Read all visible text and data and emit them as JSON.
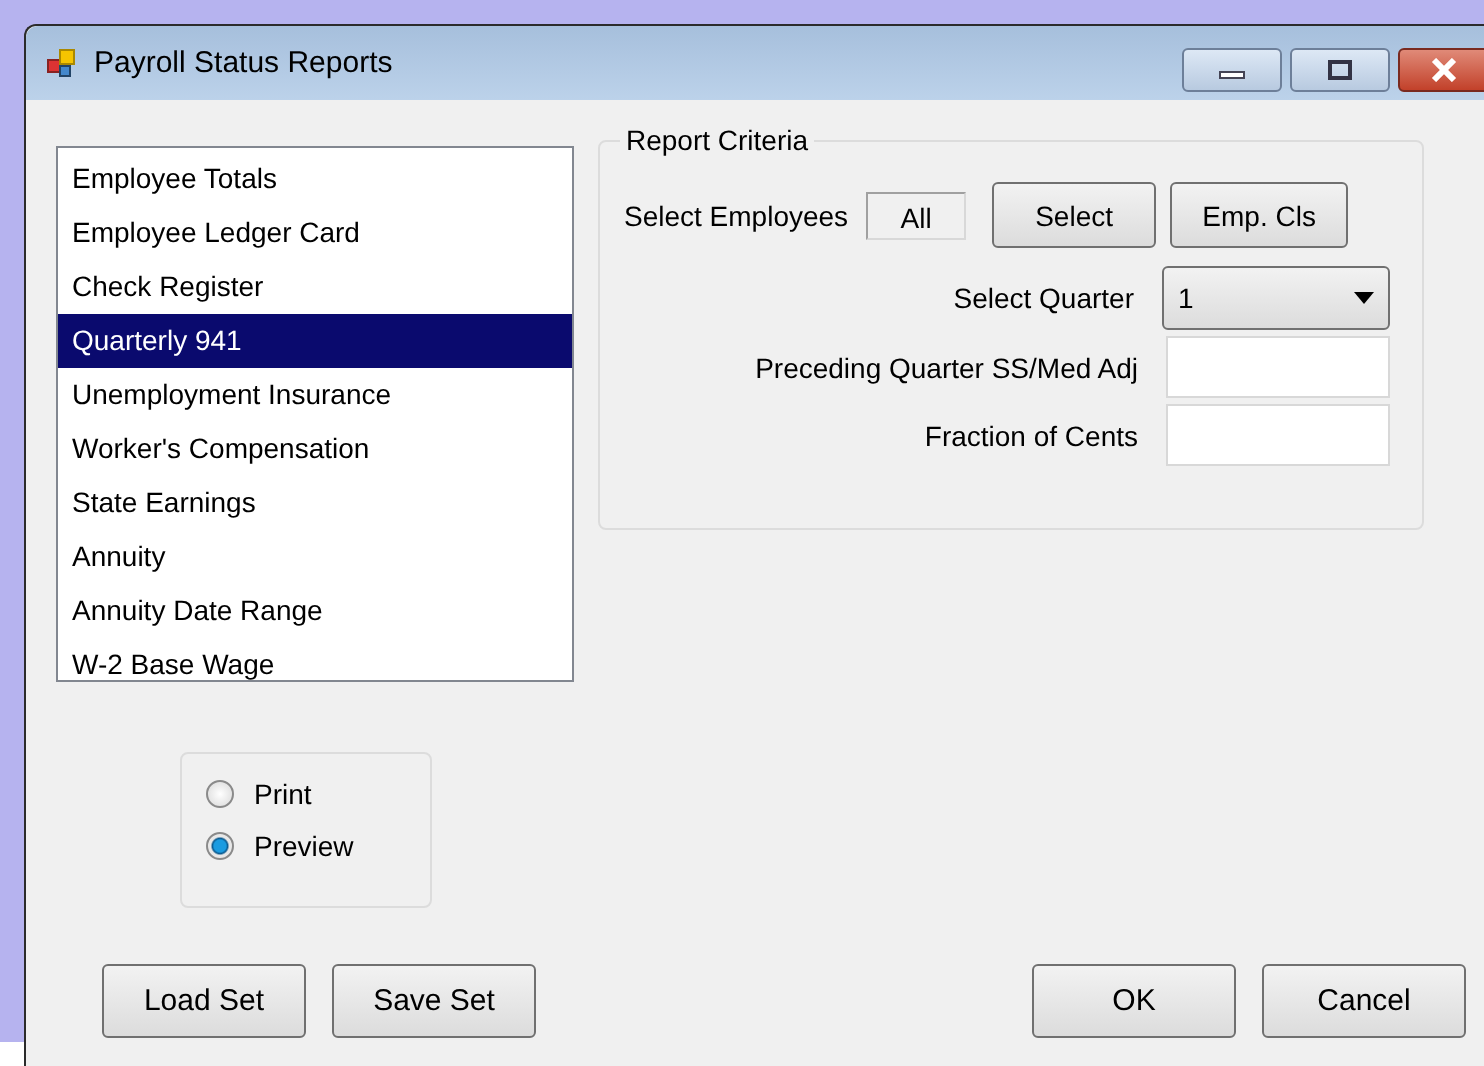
{
  "window": {
    "title": "Payroll Status Reports"
  },
  "reports": [
    {
      "label": "Employee Totals",
      "selected": false
    },
    {
      "label": "Employee Ledger Card",
      "selected": false
    },
    {
      "label": "Check Register",
      "selected": false
    },
    {
      "label": "Quarterly 941",
      "selected": true
    },
    {
      "label": "Unemployment Insurance",
      "selected": false
    },
    {
      "label": "Worker's Compensation",
      "selected": false
    },
    {
      "label": "State Earnings",
      "selected": false
    },
    {
      "label": "Annuity",
      "selected": false
    },
    {
      "label": "Annuity Date Range",
      "selected": false
    },
    {
      "label": "W-2 Base Wage",
      "selected": false
    }
  ],
  "report_criteria": {
    "title": "Report Criteria",
    "select_employees_label": "Select Employees",
    "select_employees_value": "All",
    "buttons": [
      "Select",
      "Emp. Cls"
    ],
    "select_quarter_label": "Select Quarter",
    "select_quarter_value": "1",
    "preceding_quarter_label": "Preceding Quarter SS/Med Adj",
    "fraction_label": "Fraction of Cents"
  },
  "output": [
    {
      "label": "Print",
      "selected": false
    },
    {
      "label": "Preview",
      "selected": true
    }
  ],
  "left_buttons": [
    "Load Set",
    "Save Set"
  ],
  "right_buttons": [
    "OK",
    "Cancel"
  ]
}
